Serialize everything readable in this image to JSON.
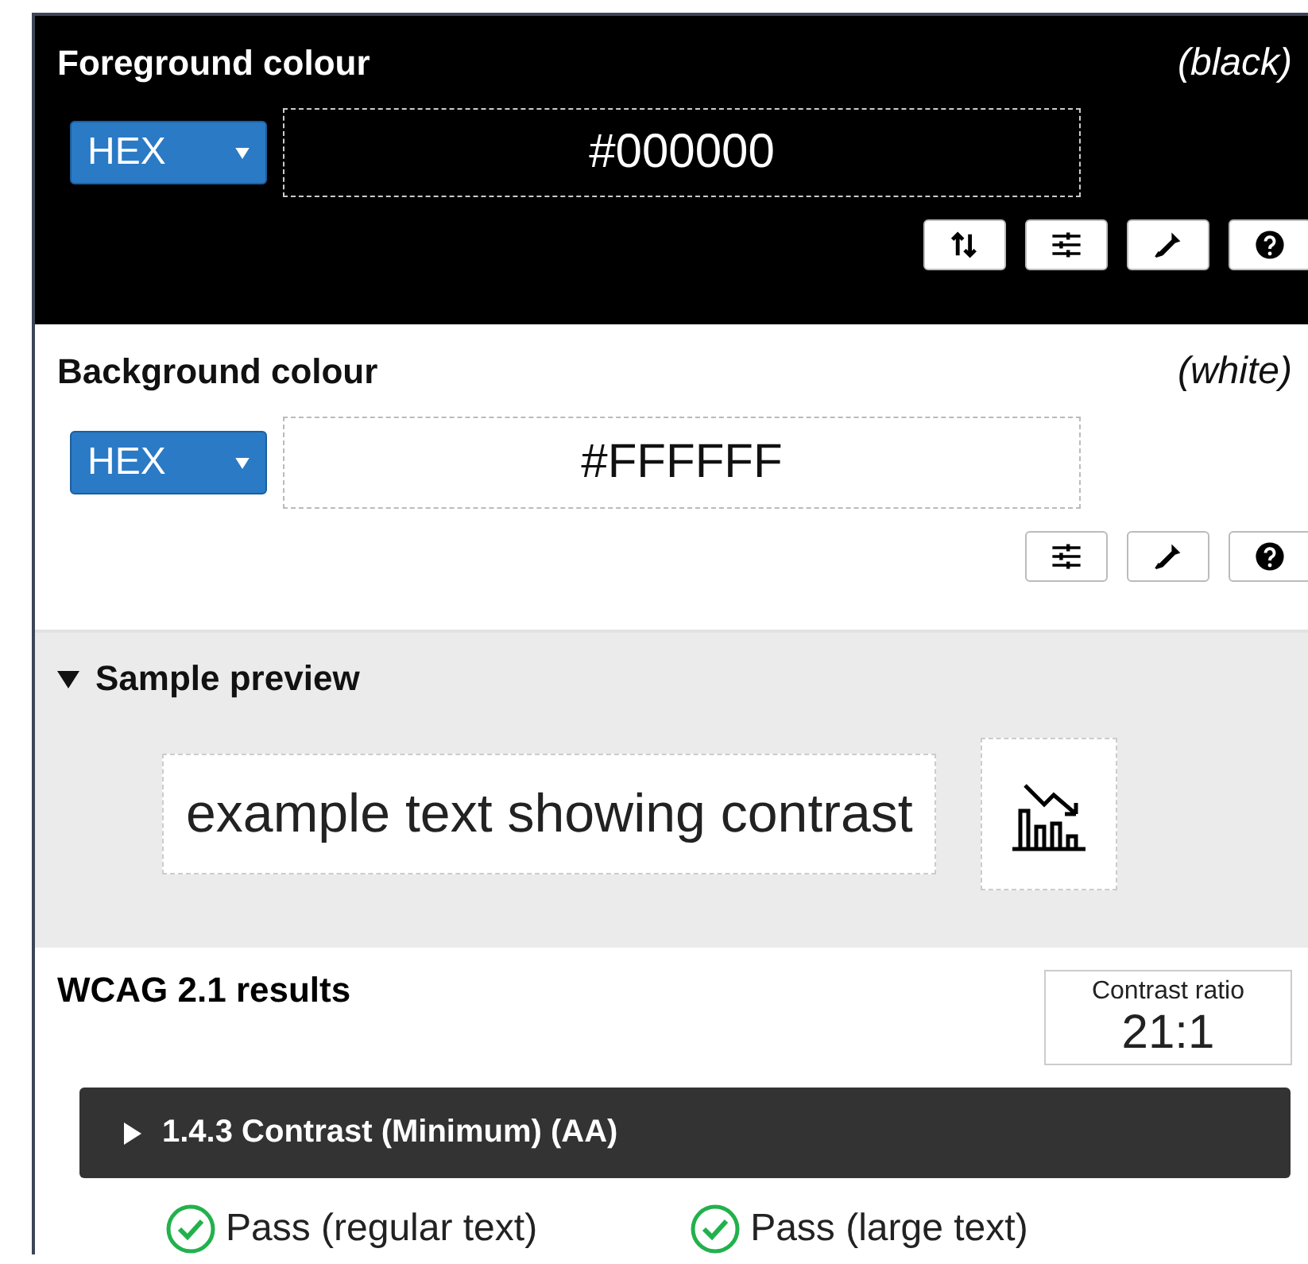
{
  "colours": [
    {
      "kind": "foreground",
      "title": "Foreground colour",
      "name": "(black)",
      "format": "HEX",
      "value": "#000000",
      "tools": [
        {
          "kind": "swap"
        },
        {
          "kind": "sliders"
        },
        {
          "kind": "picker"
        },
        {
          "kind": "help"
        }
      ]
    },
    {
      "kind": "background",
      "title": "Background colour",
      "name": "(white)",
      "format": "HEX",
      "value": "#FFFFFF",
      "tools": [
        {
          "kind": "sliders"
        },
        {
          "kind": "picker"
        },
        {
          "kind": "help"
        }
      ]
    }
  ],
  "preview": {
    "title": "Sample preview",
    "expanded": true,
    "sample_text": "example text showing contrast"
  },
  "results": {
    "title": "WCAG 2.1 results",
    "ratio_label": "Contrast ratio",
    "ratio": "21:1",
    "criteria": [
      {
        "title": "1.4.3 Contrast (Minimum) (AA)",
        "expanded": false,
        "outcomes": [
          {
            "label": "Pass (regular text)",
            "passed": true
          },
          {
            "label": "Pass (large text)",
            "passed": true
          }
        ]
      }
    ]
  }
}
